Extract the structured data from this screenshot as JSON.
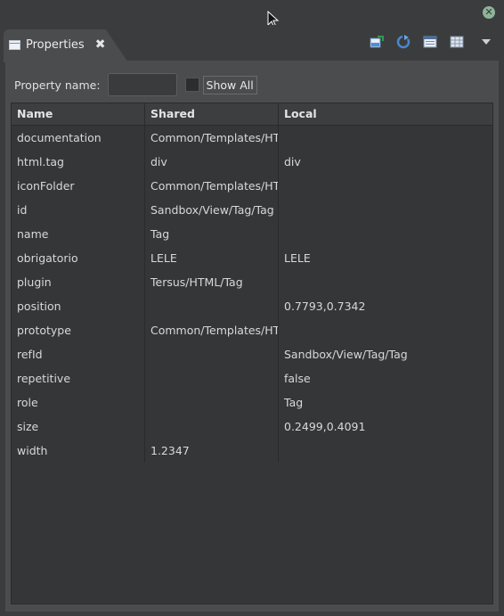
{
  "tab": {
    "label": "Properties"
  },
  "filter": {
    "label": "Property name:",
    "value": "",
    "show_all_label": "Show All"
  },
  "table": {
    "columns": [
      "Name",
      "Shared",
      "Local"
    ],
    "rows": [
      [
        "documentation",
        "Common/Templates/HTM",
        ""
      ],
      [
        "html.tag",
        "div",
        "div"
      ],
      [
        "iconFolder",
        "Common/Templates/HTM",
        ""
      ],
      [
        "id",
        "Sandbox/View/Tag/Tag",
        ""
      ],
      [
        "name",
        "Tag",
        ""
      ],
      [
        "obrigatorio",
        "LELE",
        "LELE"
      ],
      [
        "plugin",
        "Tersus/HTML/Tag",
        ""
      ],
      [
        "position",
        "",
        "0.7793,0.7342"
      ],
      [
        "prototype",
        "Common/Templates/HTM",
        ""
      ],
      [
        "refId",
        "",
        "Sandbox/View/Tag/Tag"
      ],
      [
        "repetitive",
        "",
        "false"
      ],
      [
        "role",
        "",
        "Tag"
      ],
      [
        "size",
        "",
        "0.2499,0.4091"
      ],
      [
        "width",
        "1.2347",
        ""
      ]
    ]
  },
  "colors": {
    "panel": "#4b4c4d",
    "table": "#353637",
    "accent": "#8fb39a"
  }
}
